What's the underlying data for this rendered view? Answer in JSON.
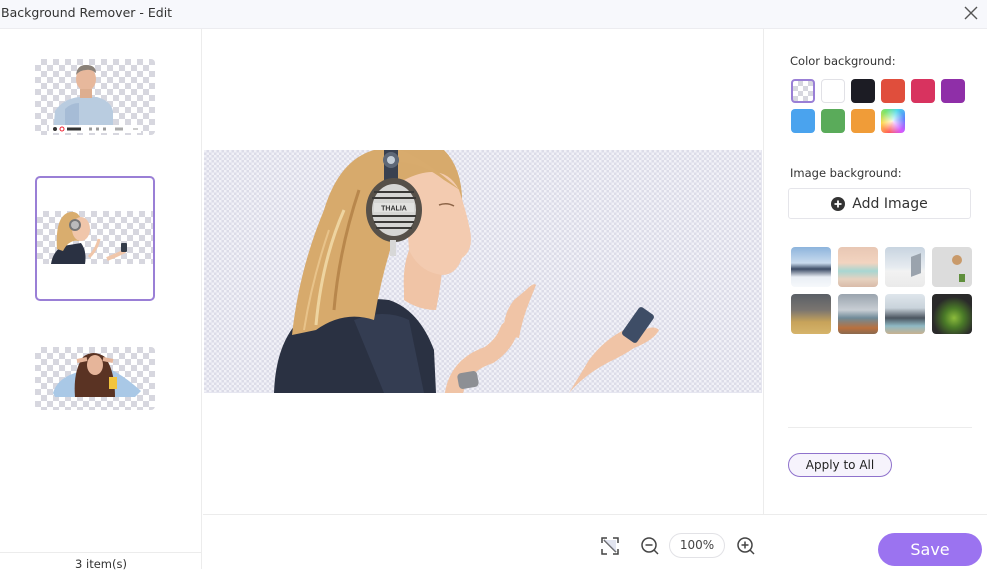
{
  "window": {
    "title": "Background Remover - Edit",
    "close_icon": "close-icon"
  },
  "sidebar": {
    "items": [
      {
        "name": "man-in-shirt-cutout",
        "selected": false
      },
      {
        "name": "woman-with-headphones-cutout",
        "selected": true
      },
      {
        "name": "woman-curly-hair-cutout",
        "selected": false
      }
    ],
    "footer_count": "3 item(s)"
  },
  "canvas": {
    "image_name": "woman-with-headphones-cutout",
    "headphone_brand_text": "THALIA"
  },
  "toolbar": {
    "fit_icon": "fit-to-screen-icon",
    "zoom_out_icon": "zoom-out-icon",
    "zoom_level": "100%",
    "zoom_in_icon": "zoom-in-icon",
    "save_label": "Save"
  },
  "right_panel": {
    "color_background_label": "Color background:",
    "colors": [
      {
        "name": "transparent",
        "value": "transparent",
        "selected": true
      },
      {
        "name": "white",
        "value": "#ffffff",
        "selected": false
      },
      {
        "name": "black",
        "value": "#1c1c24",
        "selected": false
      },
      {
        "name": "red",
        "value": "#e04e3c",
        "selected": false
      },
      {
        "name": "pink",
        "value": "#d8335f",
        "selected": false
      },
      {
        "name": "purple",
        "value": "#8f2fa8",
        "selected": false
      },
      {
        "name": "blue",
        "value": "#4aa3ee",
        "selected": false
      },
      {
        "name": "green",
        "value": "#5aab5a",
        "selected": false
      },
      {
        "name": "orange",
        "value": "#f09c38",
        "selected": false
      },
      {
        "name": "custom-gradient",
        "value": "rainbow",
        "selected": false
      }
    ],
    "image_background_label": "Image background:",
    "add_image_label": "Add Image",
    "backgrounds": [
      {
        "name": "snowy-mountains"
      },
      {
        "name": "sunset-beach"
      },
      {
        "name": "white-terrace"
      },
      {
        "name": "white-wall-plant"
      },
      {
        "name": "modern-lobby"
      },
      {
        "name": "office-lounge"
      },
      {
        "name": "office-workspace"
      },
      {
        "name": "plant-shelf-dark"
      }
    ],
    "apply_all_label": "Apply to All"
  },
  "colors": {
    "accent": "#9b73f0",
    "selection_border": "#9a7fd6"
  }
}
